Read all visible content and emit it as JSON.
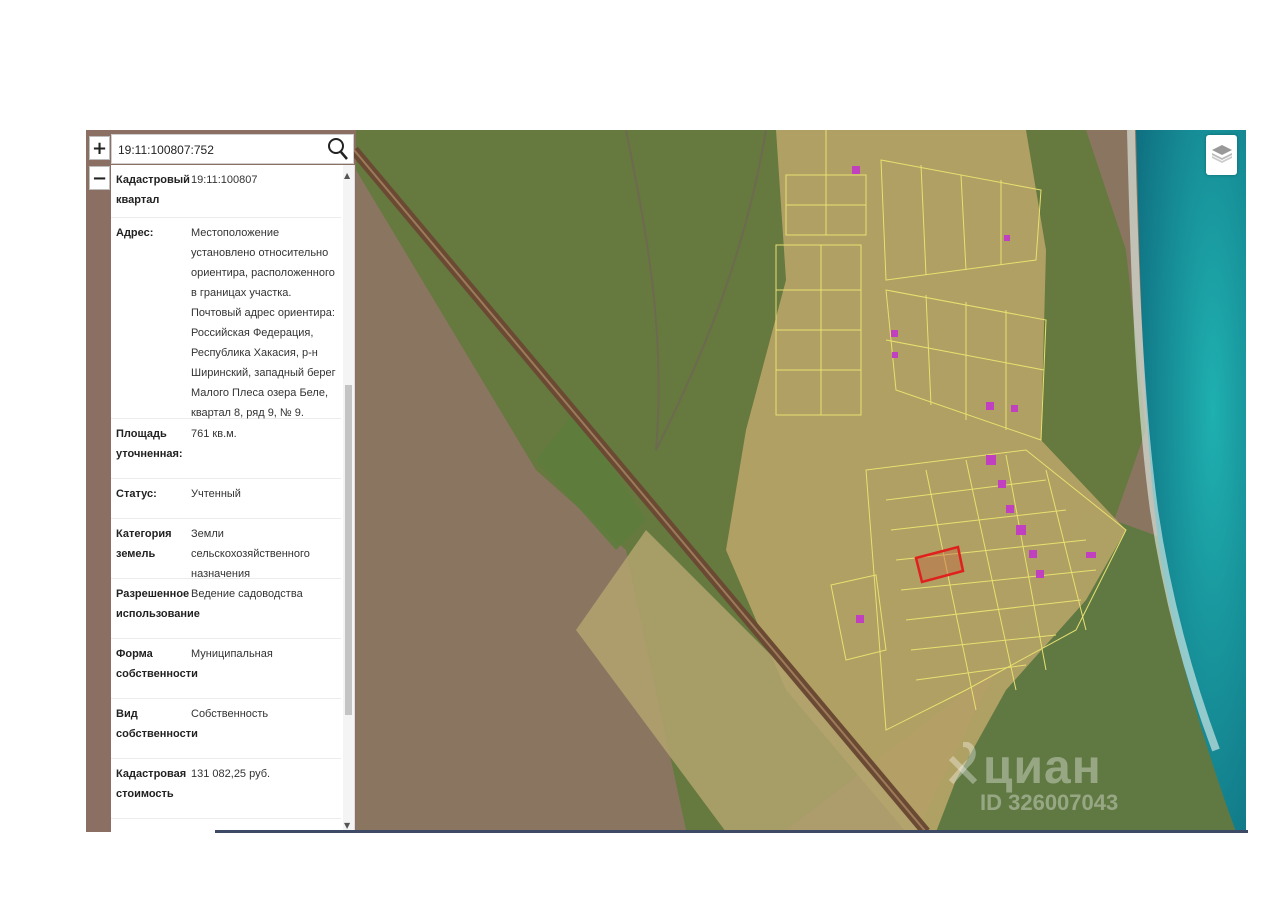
{
  "controls": {
    "zoom_in": "+",
    "zoom_out": "−"
  },
  "search": {
    "value": "19:11:100807:752"
  },
  "info": {
    "rows": [
      {
        "label": "Кадастровый квартал",
        "value": "19:11:100807"
      },
      {
        "label": "Адрес:",
        "value": "Местоположение установлено относительно ориентира, расположенного в границах участка. Почтовый адрес ориентира: Российская Федерация, Республика Хакасия, р-н Ширинский, западный берег Малого Плеса озера Беле, квартал 8, ряд 9, № 9."
      },
      {
        "label": "Площадь уточненная:",
        "value": "761 кв.м."
      },
      {
        "label": "Статус:",
        "value": "Учтенный"
      },
      {
        "label": "Категория земель",
        "value": "Земли сельскохозяйственного назначения"
      },
      {
        "label": "Разрешенное использование",
        "value": "Ведение садоводства"
      },
      {
        "label": "Форма собственности",
        "value": "Муниципальная"
      },
      {
        "label": "Вид собственности",
        "value": "Собственность"
      },
      {
        "label": "Кадастровая стоимость",
        "value": "131 082,25 руб."
      }
    ]
  },
  "icons": {
    "search": "search-icon",
    "layers": "layers-icon",
    "scroll_up": "▲",
    "scroll_down": "▼"
  },
  "watermark": {
    "brand": "циан",
    "id": "ID 326007043"
  },
  "colors": {
    "parcel_outline": "#e8e070",
    "selected_parcel": "#e0201c",
    "building": "#c040c0",
    "water": "#1aa0a0"
  }
}
